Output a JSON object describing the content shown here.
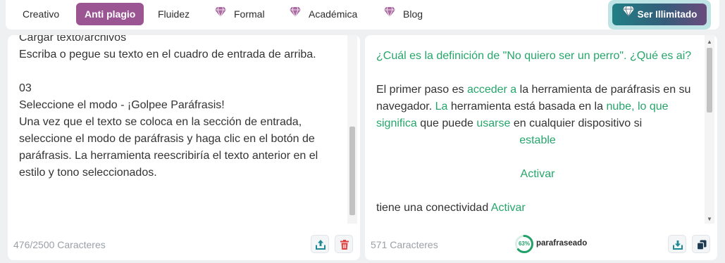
{
  "modes": [
    {
      "label": "Creativo",
      "active": false,
      "premium": false
    },
    {
      "label": "Anti plagio",
      "active": true,
      "premium": false
    },
    {
      "label": "Fluidez",
      "active": false,
      "premium": false
    },
    {
      "label": "Formal",
      "active": false,
      "premium": true
    },
    {
      "label": "Académica",
      "active": false,
      "premium": true
    },
    {
      "label": "Blog",
      "active": false,
      "premium": true
    }
  ],
  "upgrade": {
    "label": "Ser Illimitado"
  },
  "colors": {
    "accent": "#9b5593",
    "green": "#26a66b",
    "delete": "#e04040",
    "upload": "#1f8a93"
  },
  "input": {
    "lines": [
      "Cargar texto/archivos",
      "Escriba o pegue su texto en el cuadro de entrada de arriba.",
      "",
      "03",
      "Seleccione el modo - ¡Golpee Paráfrasis!",
      "Una vez que el texto se coloca en la sección de entrada,",
      "seleccione el modo de paráfrasis y haga clic en el botón de",
      "paráfrasis. La herramienta reescribiría el texto anterior en el",
      "estilo y tono seleccionados."
    ],
    "char_count": "476/2500 Caracteres",
    "scroll_fraction": 0.55
  },
  "output": {
    "question_part1": "¿Cuál es la definición de \"No quiero ser un perro\".",
    "question_part2": "¿Qué es ai?",
    "para": [
      {
        "text": "El primer paso es ",
        "changed": false
      },
      {
        "text": "acceder a",
        "changed": true
      },
      {
        "text": " la herramienta de paráfrasis en su navegador. ",
        "changed": false
      },
      {
        "text": "La",
        "changed": true
      },
      {
        "text": " herramienta está basada en la ",
        "changed": false
      },
      {
        "text": "nube, lo que significa",
        "changed": true
      },
      {
        "text": " que puede ",
        "changed": false
      },
      {
        "text": "usarse",
        "changed": true
      },
      {
        "text": " en cualquier dispositivo si",
        "changed": false
      }
    ],
    "word_stable": "estable",
    "word_activate1": "Activar",
    "last_line_text": "tiene una conectividad",
    "word_activate2": "Activar",
    "char_count": "571 Caracteres",
    "percent_label": "63%",
    "percent_value": 63,
    "status_label": "parafraseado"
  },
  "icons": {
    "premium": "gem-icon",
    "upload": "upload-icon",
    "delete": "trash-icon",
    "download": "download-icon",
    "copy": "copy-icon",
    "scroll_up": "scroll-up-arrow",
    "scroll_down": "scroll-down-arrow"
  }
}
